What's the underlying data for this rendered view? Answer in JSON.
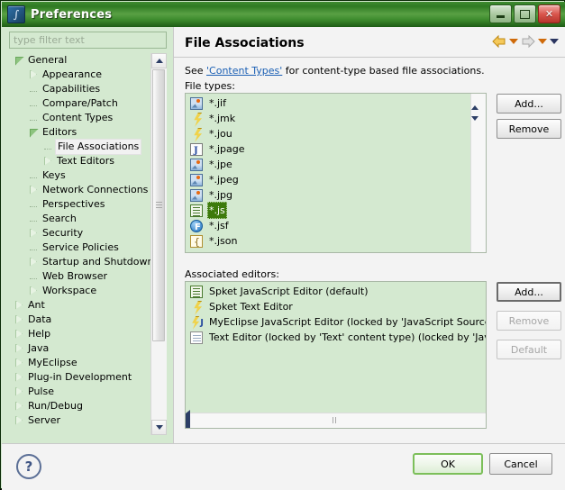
{
  "window": {
    "title": "Preferences",
    "icon": "preferences-icon",
    "controls": {
      "minimize": "minimize-icon",
      "maximize": "maximize-icon",
      "close": "close-icon"
    }
  },
  "colors": {
    "title_bar": "#2e7a22",
    "panel_bg": "#d4e9d0",
    "right_pane_bg": "#f3f3f3",
    "selection": "#3d7a0c",
    "link": "#1a5fb4",
    "ok_border": "#7cbf5a",
    "nav_enabled": "#cf6a0a"
  },
  "sidebar": {
    "filter_placeholder": "type filter text",
    "filter_value": "",
    "tree": [
      {
        "label": "General",
        "indent": 0,
        "state": "expanded",
        "selected": false
      },
      {
        "label": "Appearance",
        "indent": 1,
        "state": "collapsed",
        "selected": false
      },
      {
        "label": "Capabilities",
        "indent": 1,
        "state": "leaf",
        "selected": false
      },
      {
        "label": "Compare/Patch",
        "indent": 1,
        "state": "leaf",
        "selected": false
      },
      {
        "label": "Content Types",
        "indent": 1,
        "state": "leaf",
        "selected": false
      },
      {
        "label": "Editors",
        "indent": 1,
        "state": "expanded",
        "selected": false
      },
      {
        "label": "File Associations",
        "indent": 2,
        "state": "leaf",
        "selected": true
      },
      {
        "label": "Text Editors",
        "indent": 2,
        "state": "collapsed",
        "selected": false
      },
      {
        "label": "Keys",
        "indent": 1,
        "state": "leaf",
        "selected": false
      },
      {
        "label": "Network Connections",
        "indent": 1,
        "state": "collapsed",
        "selected": false
      },
      {
        "label": "Perspectives",
        "indent": 1,
        "state": "leaf",
        "selected": false
      },
      {
        "label": "Search",
        "indent": 1,
        "state": "leaf",
        "selected": false
      },
      {
        "label": "Security",
        "indent": 1,
        "state": "collapsed",
        "selected": false
      },
      {
        "label": "Service Policies",
        "indent": 1,
        "state": "leaf",
        "selected": false
      },
      {
        "label": "Startup and Shutdown",
        "indent": 1,
        "state": "collapsed",
        "selected": false
      },
      {
        "label": "Web Browser",
        "indent": 1,
        "state": "leaf",
        "selected": false
      },
      {
        "label": "Workspace",
        "indent": 1,
        "state": "collapsed",
        "selected": false
      },
      {
        "label": "Ant",
        "indent": 0,
        "state": "collapsed",
        "selected": false
      },
      {
        "label": "Data",
        "indent": 0,
        "state": "collapsed",
        "selected": false
      },
      {
        "label": "Help",
        "indent": 0,
        "state": "collapsed",
        "selected": false
      },
      {
        "label": "Java",
        "indent": 0,
        "state": "collapsed",
        "selected": false
      },
      {
        "label": "MyEclipse",
        "indent": 0,
        "state": "collapsed",
        "selected": false
      },
      {
        "label": "Plug-in Development",
        "indent": 0,
        "state": "collapsed",
        "selected": false
      },
      {
        "label": "Pulse",
        "indent": 0,
        "state": "collapsed",
        "selected": false
      },
      {
        "label": "Run/Debug",
        "indent": 0,
        "state": "collapsed",
        "selected": false
      },
      {
        "label": "Server",
        "indent": 0,
        "state": "collapsed",
        "selected": false
      }
    ]
  },
  "page": {
    "title": "File Associations",
    "nav": {
      "back": "back-arrow-icon",
      "back_menu": "dropdown-caret-icon",
      "forward": "forward-arrow-icon",
      "forward_menu": "dropdown-caret-icon",
      "view_menu": "view-menu-caret-icon"
    },
    "description_prefix": "See ",
    "description_link": "'Content Types'",
    "description_suffix": " for content-type based file associations.",
    "file_types_label": "File types:",
    "associated_editors_label": "Associated editors:",
    "file_types": [
      {
        "name": "*.jif",
        "icon": "image-file-icon",
        "selected": false
      },
      {
        "name": "*.jmk",
        "icon": "bolt-file-icon",
        "selected": false
      },
      {
        "name": "*.jou",
        "icon": "bolt-file-icon",
        "selected": false
      },
      {
        "name": "*.jpage",
        "icon": "java-scrapbook-icon",
        "selected": false
      },
      {
        "name": "*.jpe",
        "icon": "image-file-icon",
        "selected": false
      },
      {
        "name": "*.jpeg",
        "icon": "image-file-icon",
        "selected": false
      },
      {
        "name": "*.jpg",
        "icon": "image-file-icon",
        "selected": false
      },
      {
        "name": "*.js",
        "icon": "javascript-file-icon",
        "selected": true
      },
      {
        "name": "*.jsf",
        "icon": "jsf-file-icon",
        "selected": false
      },
      {
        "name": "*.json",
        "icon": "json-file-icon",
        "selected": false
      }
    ],
    "associated_editors": [
      {
        "name": "Spket JavaScript Editor (default)",
        "icon": "javascript-editor-icon",
        "selected": false
      },
      {
        "name": "Spket Text Editor",
        "icon": "bolt-file-icon",
        "selected": false
      },
      {
        "name": "MyEclipse JavaScript Editor (locked by 'JavaScript Source File' cont",
        "icon": "myeclipse-js-editor-icon",
        "selected": false
      },
      {
        "name": "Text Editor (locked by 'Text' content type) (locked by 'JavaScript",
        "icon": "text-editor-icon",
        "selected": false
      }
    ],
    "file_type_buttons": {
      "add": "Add...",
      "remove": "Remove"
    },
    "editor_buttons": {
      "add": "Add...",
      "remove": "Remove",
      "default": "Default"
    }
  },
  "footer": {
    "help": "?",
    "ok": "OK",
    "cancel": "Cancel"
  }
}
